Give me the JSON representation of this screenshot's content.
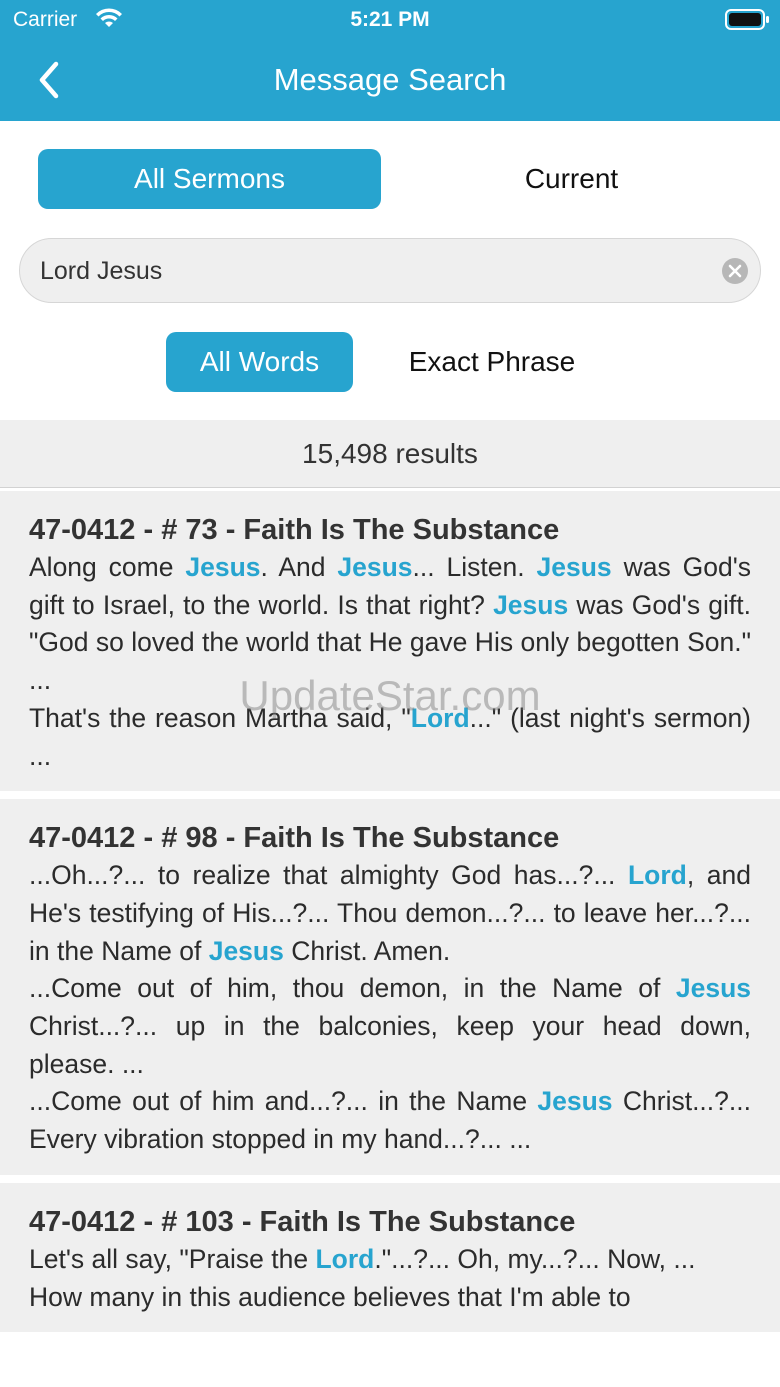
{
  "status_bar": {
    "carrier": "Carrier",
    "time": "5:21 PM"
  },
  "nav": {
    "title": "Message Search"
  },
  "scope_tabs": {
    "all": "All Sermons",
    "current": "Current"
  },
  "search": {
    "value": "Lord Jesus",
    "placeholder": ""
  },
  "mode_tabs": {
    "all_words": "All Words",
    "exact_phrase": "Exact Phrase"
  },
  "results": {
    "count_text": "15,498  results"
  },
  "watermark": "UpdateStar.com",
  "colors": {
    "accent": "#27a4cf",
    "card_bg": "#efefef"
  },
  "icons": {
    "back": "chevron-left-icon",
    "clear": "clear-circle-icon",
    "wifi": "wifi-icon",
    "battery": "battery-icon"
  },
  "result_items": [
    {
      "title": "47-0412 - # 73 - Faith Is The Substance",
      "paragraphs": [
        [
          {
            "t": "Along come "
          },
          {
            "t": "Jesus",
            "h": true
          },
          {
            "t": ". And "
          },
          {
            "t": "Jesus",
            "h": true
          },
          {
            "t": "... Listen. "
          },
          {
            "t": "Jesus",
            "h": true
          },
          {
            "t": " was God's gift to Israel, to the world. Is that right? "
          },
          {
            "t": "Jesus",
            "h": true
          },
          {
            "t": " was God's gift. \"God so loved the world that He gave His only begotten Son.\"  ..."
          }
        ],
        [
          {
            "t": "That's the reason Martha said, \""
          },
          {
            "t": "Lord",
            "h": true
          },
          {
            "t": "...\" (last night's sermon)  ..."
          }
        ]
      ]
    },
    {
      "title": "47-0412 - # 98 - Faith Is The Substance",
      "paragraphs": [
        [
          {
            "t": "...Oh...?... to realize that almighty God has...?... "
          },
          {
            "t": "Lord",
            "h": true
          },
          {
            "t": ", and He's testifying of His...?... Thou demon...?... to leave her...?... in the Name of "
          },
          {
            "t": "Jesus",
            "h": true
          },
          {
            "t": " Christ. Amen."
          }
        ],
        [
          {
            "t": "...Come out of him, thou demon, in the Name of "
          },
          {
            "t": "Jesus",
            "h": true
          },
          {
            "t": " Christ...?... up in the balconies, keep your head down, please.  ..."
          }
        ],
        [
          {
            "t": "...Come out of him and...?... in the Name "
          },
          {
            "t": "Jesus",
            "h": true
          },
          {
            "t": " Christ...?... Every vibration stopped in my hand...?...  ..."
          }
        ]
      ]
    },
    {
      "title": "47-0412 - # 103 - Faith Is The Substance",
      "paragraphs": [
        [
          {
            "t": "Let's all say, \"Praise the "
          },
          {
            "t": "Lord",
            "h": true
          },
          {
            "t": ".\"...?... Oh, my...?... Now,  ..."
          }
        ],
        [
          {
            "t": "How many in this audience believes that I'm able to"
          }
        ]
      ]
    }
  ]
}
